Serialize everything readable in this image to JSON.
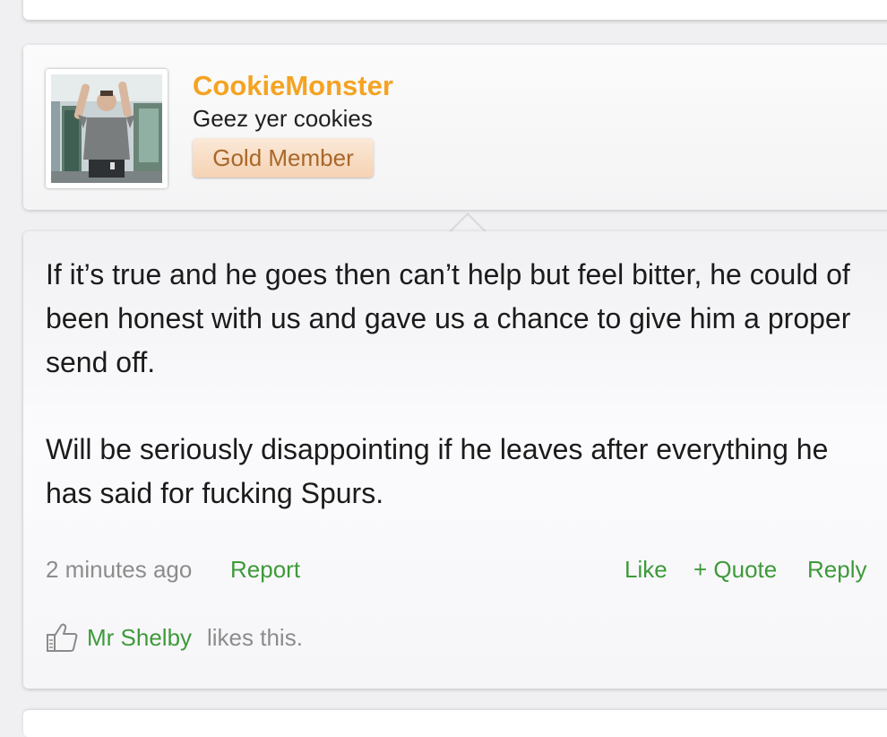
{
  "post": {
    "author": {
      "username": "CookieMonster",
      "custom_title": "Geez yer cookies",
      "badge": "Gold Member"
    },
    "message": {
      "paragraphs": [
        "If it’s true and he goes then can’t help but feel bitter, he could of been honest with us and gave us a chance to give him a proper send off.",
        "Will be seriously disappointing if he leaves after everything he has said for fucking Spurs."
      ]
    },
    "meta": {
      "time": "2 minutes ago",
      "report_label": "Report",
      "like_label": "Like",
      "quote_label": "+ Quote",
      "reply_label": "Reply"
    },
    "likes": {
      "user": "Mr Shelby",
      "suffix": "likes this."
    }
  },
  "colors": {
    "username": "#f4a322",
    "link": "#3e9a3a",
    "badge_text": "#a8672a"
  }
}
